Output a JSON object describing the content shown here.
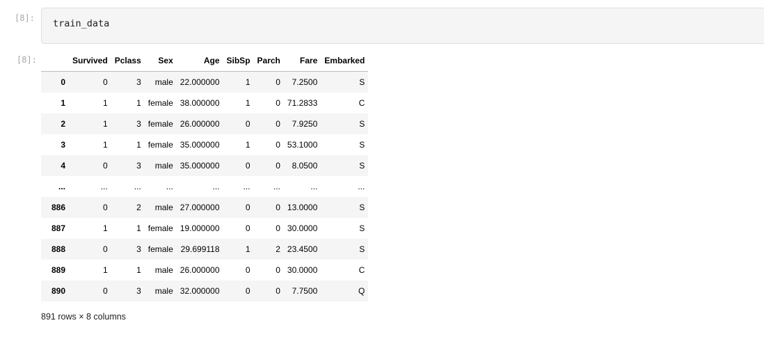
{
  "cell": {
    "input_prompt": "[8]:",
    "output_prompt": "[8]:",
    "code": "train_data"
  },
  "table": {
    "columns": [
      "",
      "Survived",
      "Pclass",
      "Sex",
      "Age",
      "SibSp",
      "Parch",
      "Fare",
      "Embarked"
    ],
    "rows": [
      [
        "0",
        "0",
        "3",
        "male",
        "22.000000",
        "1",
        "0",
        "7.2500",
        "S"
      ],
      [
        "1",
        "1",
        "1",
        "female",
        "38.000000",
        "1",
        "0",
        "71.2833",
        "C"
      ],
      [
        "2",
        "1",
        "3",
        "female",
        "26.000000",
        "0",
        "0",
        "7.9250",
        "S"
      ],
      [
        "3",
        "1",
        "1",
        "female",
        "35.000000",
        "1",
        "0",
        "53.1000",
        "S"
      ],
      [
        "4",
        "0",
        "3",
        "male",
        "35.000000",
        "0",
        "0",
        "8.0500",
        "S"
      ],
      [
        "...",
        "...",
        "...",
        "...",
        "...",
        "...",
        "...",
        "...",
        "..."
      ],
      [
        "886",
        "0",
        "2",
        "male",
        "27.000000",
        "0",
        "0",
        "13.0000",
        "S"
      ],
      [
        "887",
        "1",
        "1",
        "female",
        "19.000000",
        "0",
        "0",
        "30.0000",
        "S"
      ],
      [
        "888",
        "0",
        "3",
        "female",
        "29.699118",
        "1",
        "2",
        "23.4500",
        "S"
      ],
      [
        "889",
        "1",
        "1",
        "male",
        "26.000000",
        "0",
        "0",
        "30.0000",
        "C"
      ],
      [
        "890",
        "0",
        "3",
        "male",
        "32.000000",
        "0",
        "0",
        "7.7500",
        "Q"
      ]
    ],
    "footer": "891 rows × 8 columns"
  }
}
